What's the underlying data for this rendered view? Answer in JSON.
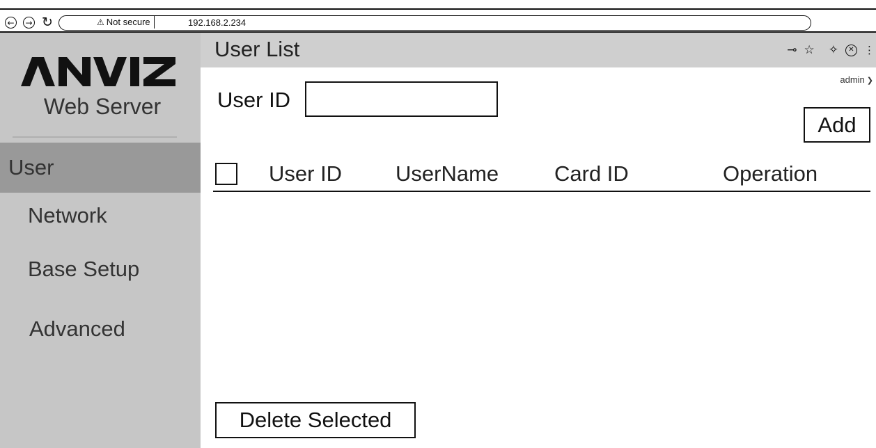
{
  "browser": {
    "security_label": "Not secure",
    "url": "192.168.2.234",
    "back_icon": "arrow-left-circle",
    "forward_icon": "arrow-right-circle",
    "reload_icon": "reload"
  },
  "sidebar": {
    "logo_text": "ANVIZ",
    "subtitle": "Web Server",
    "items": [
      {
        "label": "User",
        "active": true
      },
      {
        "label": "Network",
        "active": false
      },
      {
        "label": "Base Setup",
        "active": false
      },
      {
        "label": "Advanced",
        "active": false
      }
    ]
  },
  "header": {
    "title": "User List",
    "icons": [
      "key-icon",
      "star-icon",
      "extension-icon",
      "close-circle-icon",
      "more-vertical-icon"
    ]
  },
  "account": {
    "user": "admin"
  },
  "search": {
    "label": "User ID",
    "value": ""
  },
  "buttons": {
    "add": "Add",
    "delete_selected": "Delete Selected"
  },
  "table": {
    "columns": [
      "User ID",
      "UserName",
      "Card ID",
      "Operation"
    ],
    "rows": []
  },
  "colors": {
    "sidebar_bg": "#c6c6c6",
    "sidebar_active_bg": "#999999",
    "header_bg": "#cfcfcf"
  }
}
